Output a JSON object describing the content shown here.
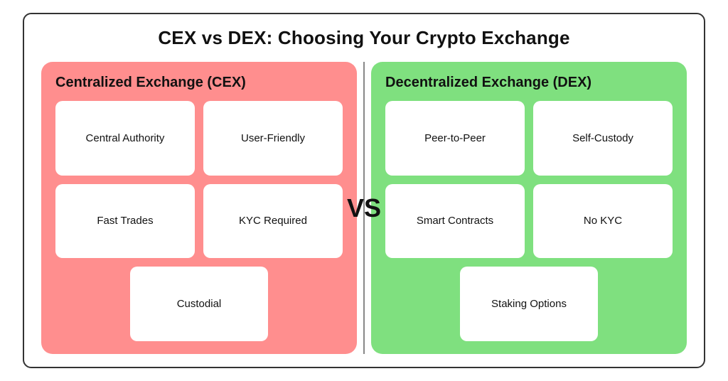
{
  "page": {
    "title": "CEX vs DEX: Choosing Your Crypto Exchange",
    "vs_label": "VS",
    "cex": {
      "panel_title": "Centralized Exchange (CEX)",
      "cards": [
        "Central Authority",
        "User-Friendly",
        "Fast Trades",
        "KYC Required",
        "Custodial"
      ]
    },
    "dex": {
      "panel_title": "Decentralized Exchange (DEX)",
      "cards": [
        "Peer-to-Peer",
        "Self-Custody",
        "Smart Contracts",
        "No KYC",
        "Staking Options"
      ]
    }
  }
}
